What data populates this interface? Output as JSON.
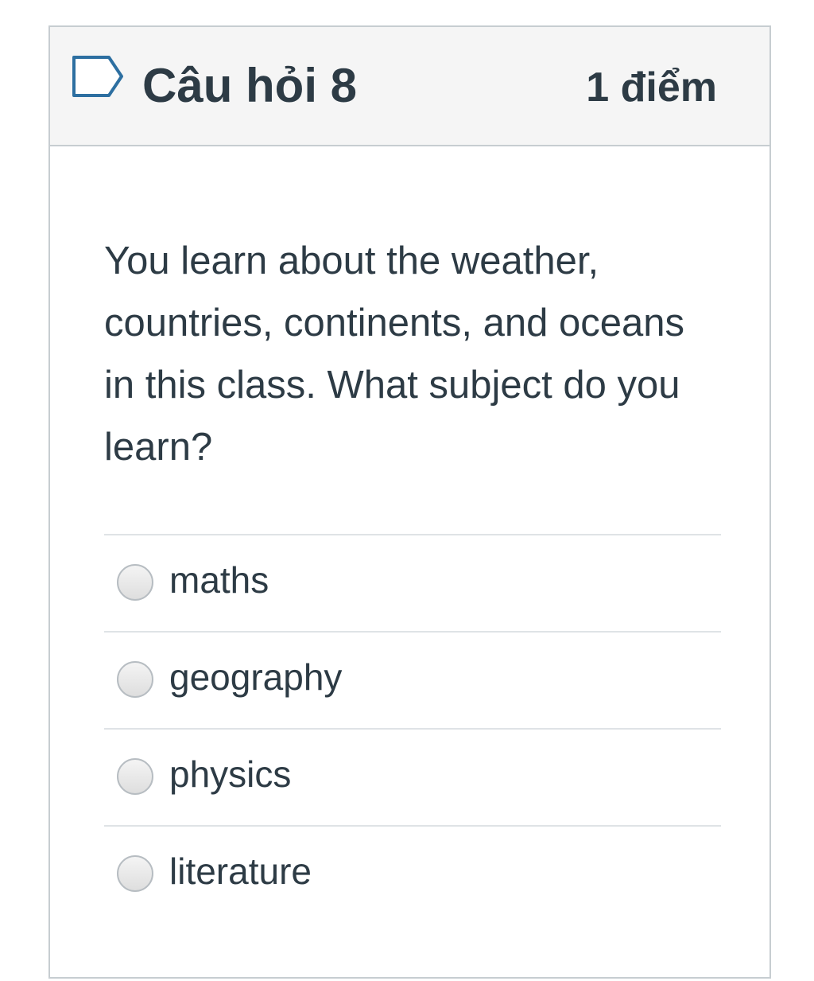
{
  "question": {
    "title": "Câu hỏi 8",
    "points": "1 điểm",
    "flag_icon": "flag-outline-icon",
    "text": "You learn about the weather, countries, continents, and oceans in this class. What subject do you learn?"
  },
  "answers": [
    {
      "label": "maths",
      "selected": false
    },
    {
      "label": "geography",
      "selected": false
    },
    {
      "label": "physics",
      "selected": false
    },
    {
      "label": "literature",
      "selected": false
    }
  ],
  "colors": {
    "text": "#2d3b45",
    "header_bg": "#f5f5f5",
    "border": "#c7cdd1",
    "divider": "#dfe3e6",
    "flag": "#2d6fa1"
  }
}
